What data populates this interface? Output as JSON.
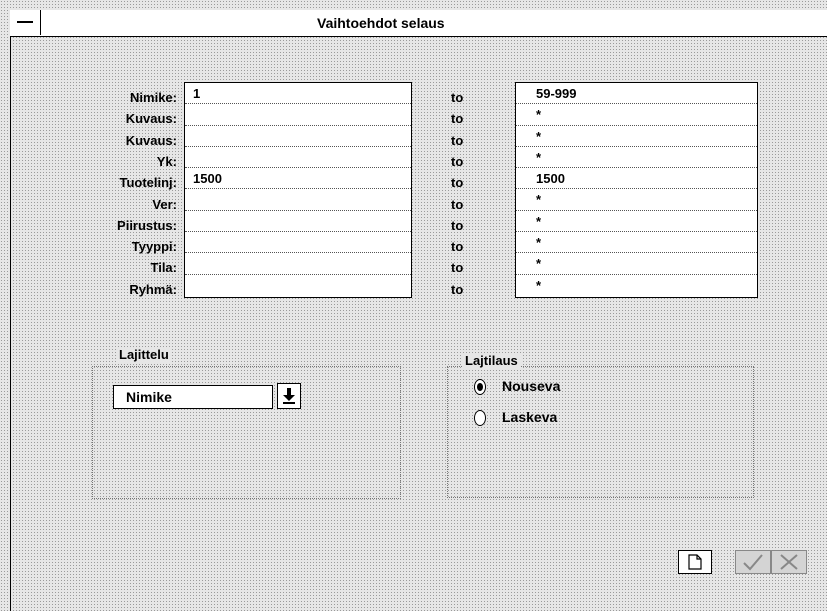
{
  "window": {
    "title": "Vaihtoehdot selaus"
  },
  "fields": [
    {
      "label": "Nimike:",
      "from": "1",
      "to_word": "to",
      "to": "59-999"
    },
    {
      "label": "Kuvaus:",
      "from": "",
      "to_word": "to",
      "to": "*"
    },
    {
      "label": "Kuvaus:",
      "from": "",
      "to_word": "to",
      "to": "*"
    },
    {
      "label": "Yk:",
      "from": "",
      "to_word": "to",
      "to": "*"
    },
    {
      "label": "Tuotelinj:",
      "from": "1500",
      "to_word": "to",
      "to": "1500"
    },
    {
      "label": "Ver:",
      "from": "",
      "to_word": "to",
      "to": "*"
    },
    {
      "label": "Piirustus:",
      "from": "",
      "to_word": "to",
      "to": "*"
    },
    {
      "label": "Tyyppi:",
      "from": "",
      "to_word": "to",
      "to": "*"
    },
    {
      "label": "Tila:",
      "from": "",
      "to_word": "to",
      "to": "*"
    },
    {
      "label": "Ryhmä:",
      "from": "",
      "to_word": "to",
      "to": "*"
    }
  ],
  "sort": {
    "group_label": "Lajittelu",
    "selected": "Nimike"
  },
  "order": {
    "group_label": "Lajtilaus",
    "options": [
      {
        "label": "Nouseva",
        "selected": true
      },
      {
        "label": "Laskeva",
        "selected": false
      }
    ]
  },
  "icons": {
    "system_menu": "system-menu-icon",
    "dropdown": "down-arrow-icon",
    "new": "document-icon",
    "ok": "check-icon",
    "cancel": "cross-icon"
  }
}
